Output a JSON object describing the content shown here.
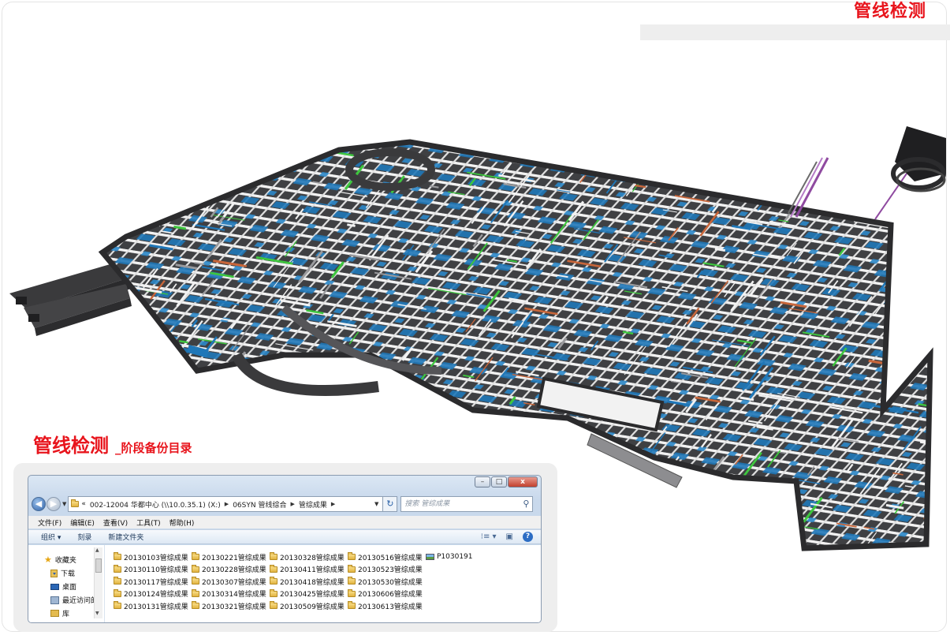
{
  "slide": {
    "top_title": "管线检测",
    "sub_heading_main": "管线检测",
    "sub_heading_suffix": "_阶段备份目录"
  },
  "explorer": {
    "window_buttons": {
      "minimize": "–",
      "maximize": "□",
      "close": "x"
    },
    "breadcrumb_prefix": "«",
    "breadcrumbs": [
      "002-12004 华都中心 (\\\\10.0.35.1) (X:)",
      "06SYN 管线综合",
      "管综成果"
    ],
    "search_placeholder": "搜索 管综成果",
    "menu": [
      "文件(F)",
      "编辑(E)",
      "查看(V)",
      "工具(T)",
      "帮助(H)"
    ],
    "toolbar": {
      "organize": "组织 ▾",
      "burn": "刻录",
      "new_folder": "新建文件夹",
      "view_icon": "⁝≡ ▾",
      "pane_icon": "▣",
      "help": "?"
    },
    "nav_items": [
      {
        "label": "收藏夹",
        "icon": "star-icon"
      },
      {
        "label": "下载",
        "icon": "download-folder-icon"
      },
      {
        "label": "桌面",
        "icon": "desktop-icon"
      },
      {
        "label": "最近访问的",
        "icon": "recent-places-icon"
      },
      {
        "label": "库",
        "icon": "library-icon"
      }
    ],
    "files": [
      [
        "20130103管综成果",
        "20130110管综成果",
        "20130117管综成果",
        "20130124管综成果",
        "20130131管综成果"
      ],
      [
        "20130221管综成果",
        "20130228管综成果",
        "20130307管综成果",
        "20130314管综成果",
        "20130321管综成果"
      ],
      [
        "20130328管综成果",
        "20130411管综成果",
        "20130418管综成果",
        "20130425管综成果",
        "20130509管综成果"
      ],
      [
        "20130516管综成果",
        "20130523管综成果",
        "20130530管综成果",
        "20130606管综成果",
        "20130613管综成果"
      ],
      [
        "P1030191"
      ]
    ],
    "image_files": [
      "P1030191"
    ]
  },
  "colors": {
    "title_red": "#e8141c",
    "slab_dark": "#4a4a4c",
    "pipe_white": "#f2f2f2",
    "pipe_blue": "#1f77b8",
    "pipe_green": "#3ec63e",
    "pipe_orange": "#c8663a",
    "pipe_purple": "#9a4aa0"
  }
}
